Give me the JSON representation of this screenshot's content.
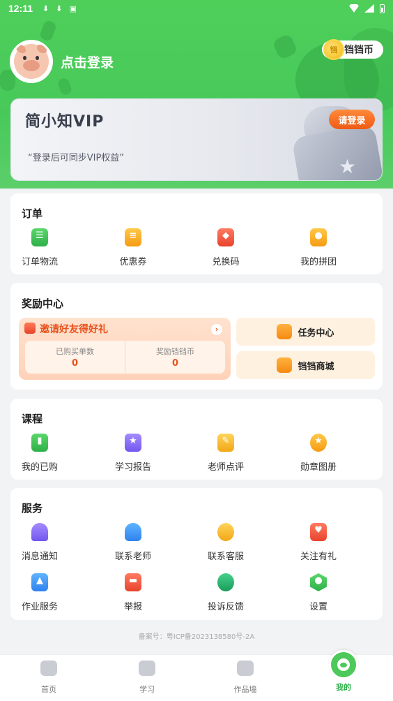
{
  "status_bar": {
    "time": "12:11",
    "icons": [
      "download-icon",
      "download-icon",
      "a-icon"
    ]
  },
  "header": {
    "login_text": "点击登录",
    "coin_label": "铛铛币",
    "coin_symbol": "铛"
  },
  "vip": {
    "title": "简小知VIP",
    "subtitle": "“登录后可同步VIP权益”",
    "button": "请登录"
  },
  "orders": {
    "title": "订单",
    "items": [
      {
        "label": "订单物流",
        "icon": "clipboard-icon"
      },
      {
        "label": "优惠券",
        "icon": "coupon-icon"
      },
      {
        "label": "兑换码",
        "icon": "gift-icon"
      },
      {
        "label": "我的拼团",
        "icon": "group-icon"
      }
    ]
  },
  "rewards": {
    "title": "奖励中心",
    "invite_title": "邀请好友得好礼",
    "purchased_label": "已购买单数",
    "purchased_value": "0",
    "coins_label": "奖励铛铛币",
    "coins_value": "0",
    "task_center": "任务中心",
    "shop": "铛铛商城"
  },
  "courses": {
    "title": "课程",
    "items": [
      {
        "label": "我的已购",
        "icon": "book-icon"
      },
      {
        "label": "学习报告",
        "icon": "report-icon"
      },
      {
        "label": "老师点评",
        "icon": "edit-note-icon"
      },
      {
        "label": "勋章图册",
        "icon": "medal-icon"
      }
    ]
  },
  "services": {
    "title": "服务",
    "items": [
      {
        "label": "消息通知",
        "icon": "bell-icon"
      },
      {
        "label": "联系老师",
        "icon": "teacher-icon"
      },
      {
        "label": "联系客服",
        "icon": "support-icon"
      },
      {
        "label": "关注有礼",
        "icon": "heart-chat-icon"
      },
      {
        "label": "作业服务",
        "icon": "graduation-cap-icon"
      },
      {
        "label": "举报",
        "icon": "report-flag-icon"
      },
      {
        "label": "投诉反馈",
        "icon": "headset-icon"
      },
      {
        "label": "设置",
        "icon": "gear-icon"
      }
    ]
  },
  "footer": {
    "note": "备案号：粤ICP备2023138580号-2A"
  },
  "bottom_nav": [
    {
      "label": "首页",
      "icon": "home-icon"
    },
    {
      "label": "学习",
      "icon": "play-icon"
    },
    {
      "label": "作品墙",
      "icon": "gallery-icon"
    },
    {
      "label": "我的",
      "icon": "pig-face-icon"
    }
  ],
  "colors": {
    "brand_green": "#4fcf5a",
    "accent_orange": "#f05a14"
  }
}
